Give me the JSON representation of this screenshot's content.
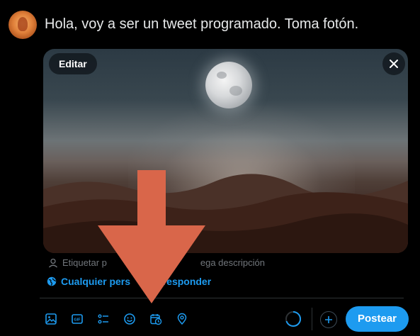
{
  "tweet": {
    "text": "Hola, voy a ser un tweet programado. Toma fotón."
  },
  "media": {
    "edit_label": "Editar",
    "close_icon": "close-icon"
  },
  "media_meta": {
    "tag_people_partial": "Etiquetar p",
    "description_partial": "ega descripción"
  },
  "reply_setting": {
    "label_part1": "Cualquier pers",
    "label_part2": "e responder"
  },
  "toolbar": {
    "icons": [
      "image-icon",
      "gif-icon",
      "poll-icon",
      "emoji-icon",
      "schedule-icon",
      "location-icon"
    ],
    "post_label": "Postear"
  },
  "colors": {
    "accent": "#1d9bf0",
    "annotation_arrow": "#d9664a",
    "background": "#000000"
  }
}
